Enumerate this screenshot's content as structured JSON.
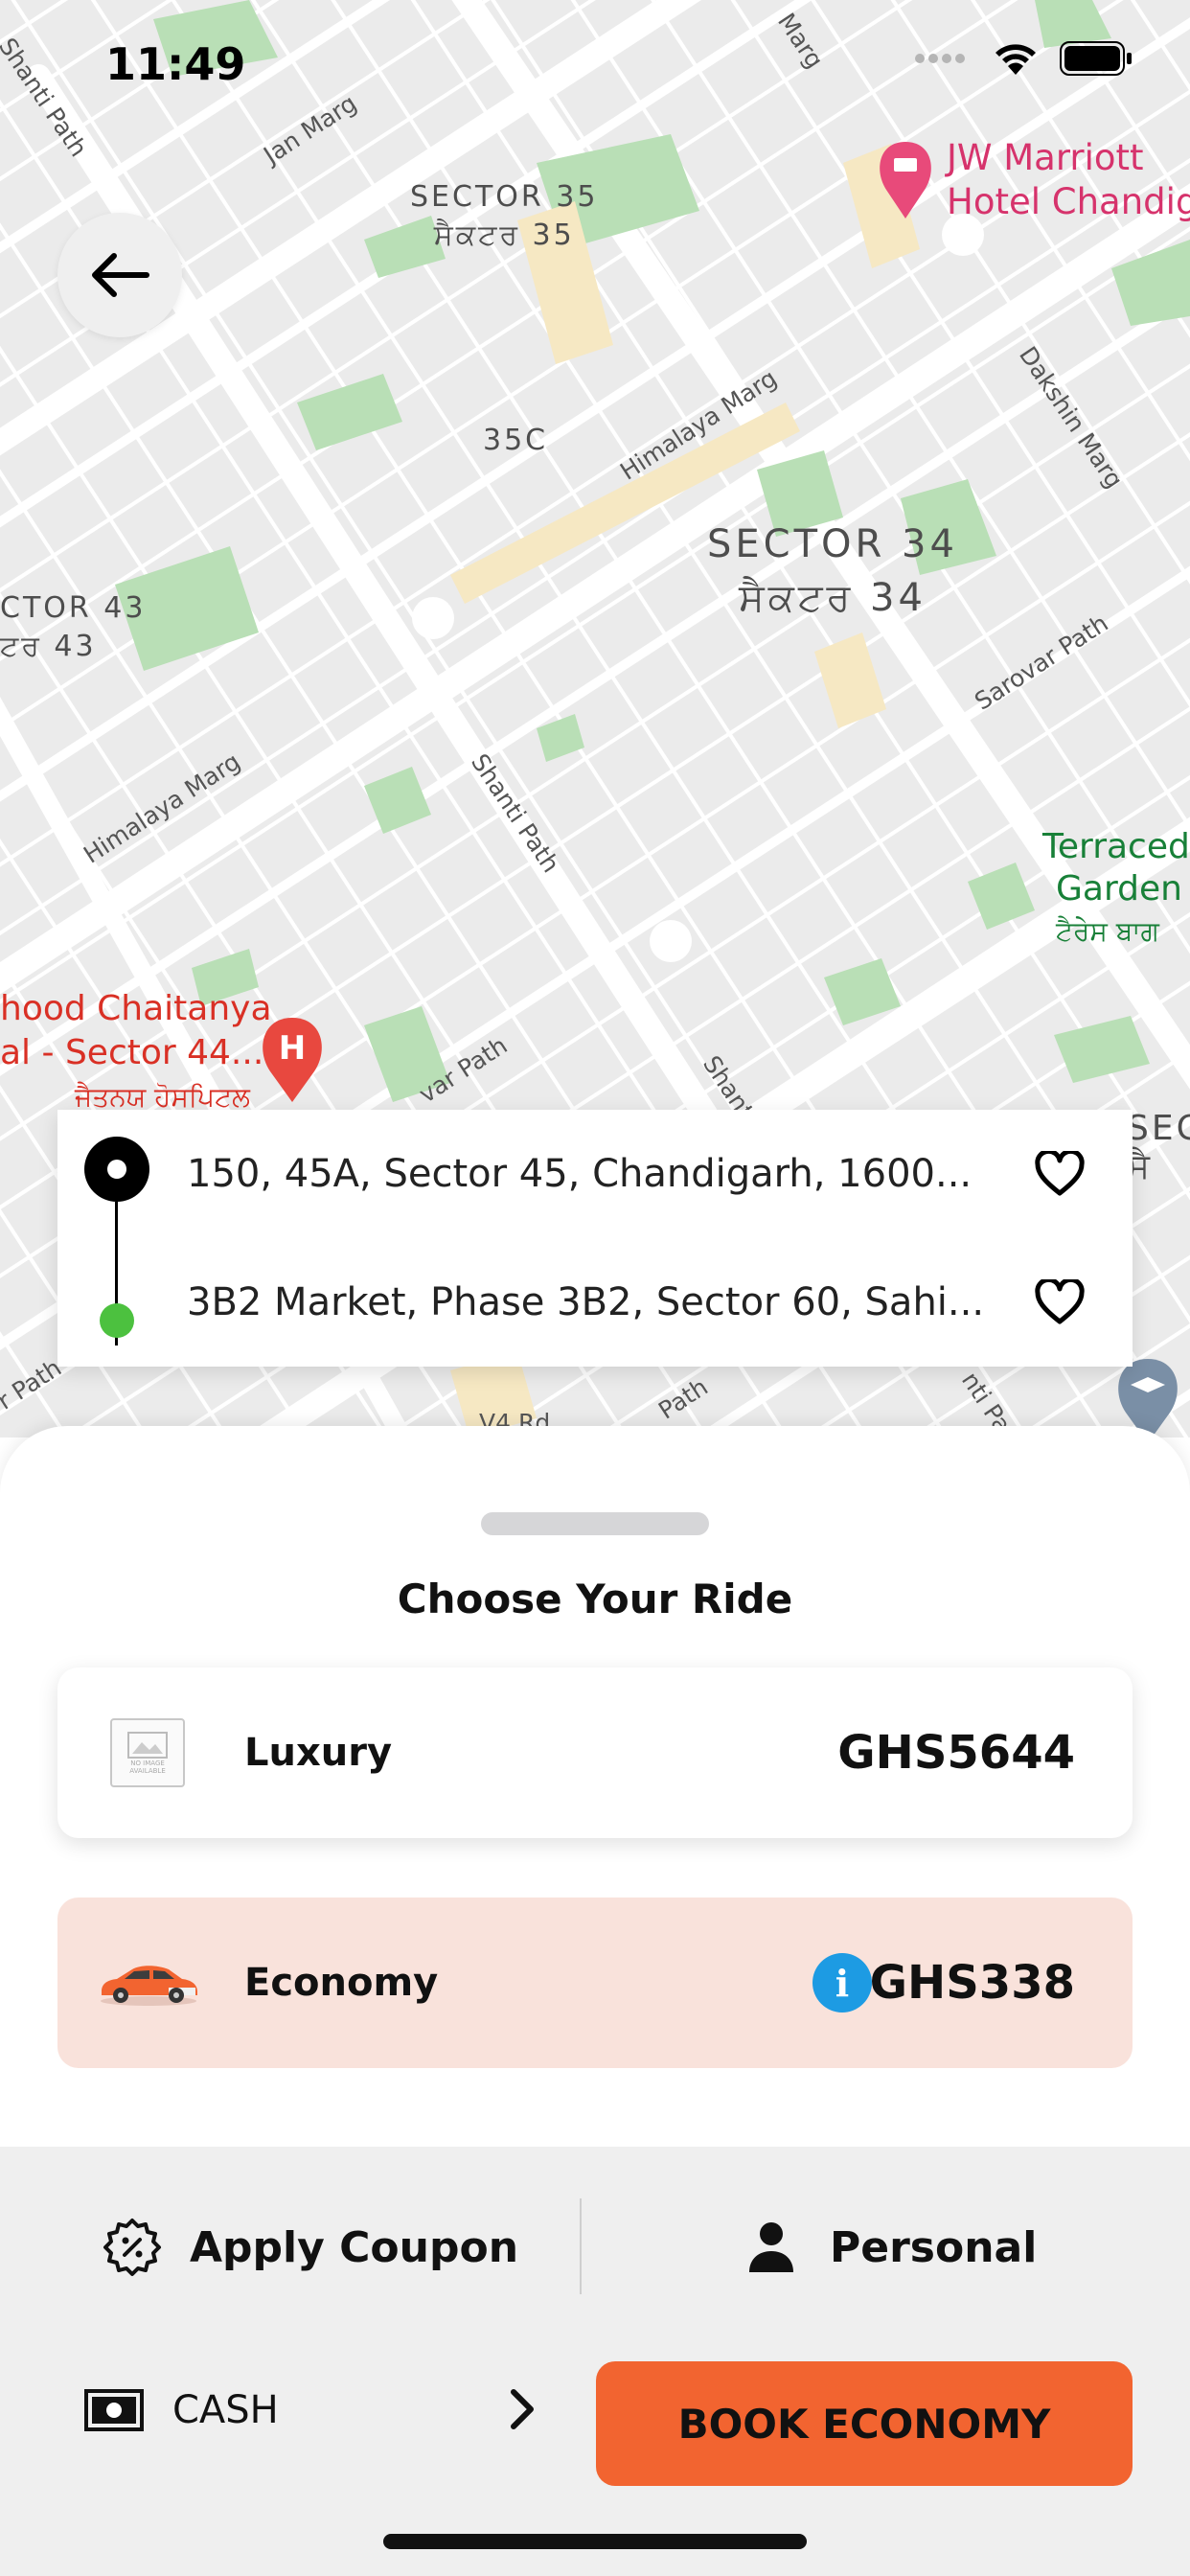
{
  "status_bar": {
    "time": "11:49"
  },
  "map": {
    "labels": {
      "jan_marg": "Jan Marg",
      "shanti_path_tl": "Shanti Path",
      "sector35_en": "SECTOR 35",
      "sector35_pa": "ਸੈਕਟਰ 35",
      "sector35c": "35C",
      "himalaya_marg_top": "Himalaya Marg",
      "sector34_en": "SECTOR 34",
      "sector34_pa": "ਸੈਕਟਰ 34",
      "sector43_en": "CTOR 43",
      "sector43_pa": "ਟਰ 43",
      "himalaya_marg_left": "Himalaya Marg",
      "shanti_path_mid": "Shanti Path",
      "sarovar_path": "Sarovar Path",
      "dakshin_marg": "Dakshin Marg",
      "marg_top": "Marg",
      "jw_marriott_1": "JW Marriott",
      "jw_marriott_2": "Hotel Chandig",
      "terraced_1": "Terraced",
      "terraced_2": "Garden",
      "terraced_pa": "ਟੈਰੇਸ ਬਾਗ",
      "hood_1": "hood Chaitanya",
      "hood_2": "al - Sector 44...",
      "hood_pa": "ਜੈਤਨਯ ਹੋਸਪਿਟਲ",
      "shanti_path_bottom": "Shanti Pa",
      "var_path": "var Path",
      "se_right": "SEC",
      "se_right_pa": "ਸੈ",
      "r_path_left": "r Path",
      "v4_rd": "V4 Rd",
      "path_bottom": "Path",
      "nti_path": "nti Pat"
    }
  },
  "route": {
    "pickup": "150, 45A, Sector 45, Chandigarh, 1600...",
    "dropoff": "3B2 Market, Phase 3B2, Sector 60, Sahi..."
  },
  "sheet": {
    "title": "Choose Your Ride",
    "rides": [
      {
        "name": "Luxury",
        "price": "GHS5644",
        "image_text": "NO IMAGE AVAILABLE"
      },
      {
        "name": "Economy",
        "price": "GHS338",
        "info": "i"
      }
    ],
    "apply_coupon": "Apply Coupon",
    "personal": "Personal",
    "payment": "CASH",
    "book_button": "BOOK ECONOMY"
  },
  "colors": {
    "accent": "#f26430",
    "economy_bg": "#f9e2db",
    "info_blue": "#1d9be3",
    "pickup_green": "#4cc13f"
  },
  "icons": [
    "back-arrow-icon",
    "wifi-icon",
    "battery-icon",
    "signal-icon",
    "heart-icon",
    "coupon-icon",
    "person-icon",
    "cash-icon",
    "chevron-right-icon",
    "info-icon",
    "car-icon",
    "hospital-pin-icon",
    "hotel-pin-icon",
    "school-pin-icon"
  ]
}
